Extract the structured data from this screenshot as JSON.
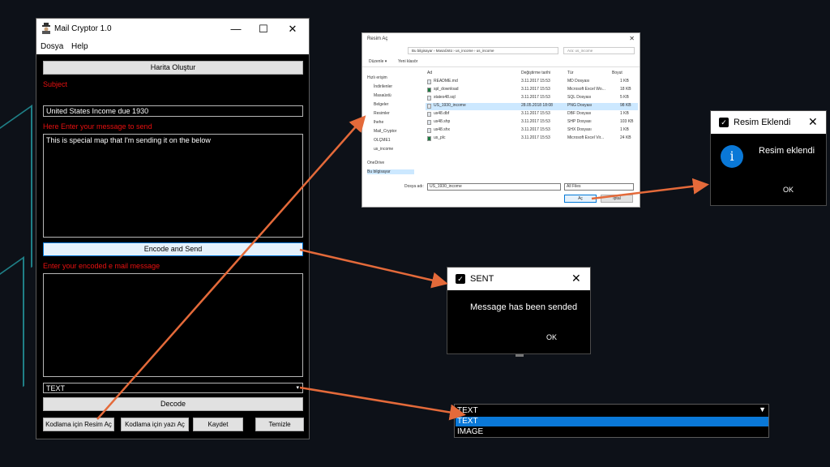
{
  "main_window": {
    "title": "Mail Cryptor 1.0",
    "menu": [
      "Dosya",
      "Help"
    ],
    "map_button": "Harita Oluştur",
    "subject_label": "Subject",
    "subject_value": "United States Income due 1930",
    "message_label": "Here Enter your message to send",
    "message_value": "This is special map that I'm sending it on  the below",
    "encode_button": "Encode and Send",
    "encoded_label": "Enter your encoded e mail message",
    "encoded_value": "",
    "type_select": "TEXT",
    "decode_button": "Decode",
    "open_image_button": "Kodlama için Resim Aç",
    "open_text_button": "Kodlama için  yazı Aç",
    "save_button": "Kaydet",
    "clear_button": "Temizle"
  },
  "file_dialog": {
    "title": "Resim Aç",
    "breadcrumb": "Bu bilgisayar › MasaÜstü › us_income › us_income",
    "search_placeholder": "Ara: us_income",
    "toolbar": [
      "Düzenle ▾",
      "Yeni klasör"
    ],
    "columns": [
      "Ad",
      "Değiştirme tarihi",
      "Tür",
      "Boyut"
    ],
    "sidebar": [
      "Hızlı erişim",
      "İndirilenler",
      "Masaüstü",
      "Belgeler",
      "Resimler",
      "lhehe",
      "Mail_Cryptor",
      "OLÇME1",
      "us_income",
      "OneDrive",
      "Bu bilgisayar"
    ],
    "files": [
      {
        "name": "README.md",
        "date": "3.11.2017 15:53",
        "type": "MD Dosyası",
        "size": "1 KB"
      },
      {
        "name": "spl_download",
        "date": "3.11.2017 15:53",
        "type": "Microsoft Excel Wo...",
        "size": "18 KB"
      },
      {
        "name": "states48.sql",
        "date": "3.11.2017 15:53",
        "type": "SQL Dosyası",
        "size": "5 KB"
      },
      {
        "name": "US_1930_income",
        "date": "28.05.2018 18:08",
        "type": "PNG Dosyası",
        "size": "98 KB"
      },
      {
        "name": "us48.dbf",
        "date": "3.11.2017 15:53",
        "type": "DBF Dosyası",
        "size": "1 KB"
      },
      {
        "name": "us48.shp",
        "date": "3.11.2017 15:53",
        "type": "SHP Dosyası",
        "size": "103 KB"
      },
      {
        "name": "us48.shx",
        "date": "3.11.2017 15:53",
        "type": "SHX Dosyası",
        "size": "1 KB"
      },
      {
        "name": "us_plc",
        "date": "3.11.2017 15:53",
        "type": "Microsoft Excel Vir...",
        "size": "24 KB"
      }
    ],
    "filename_label": "Dosya adı:",
    "filename_value": "US_1930_income",
    "filter": "All Files",
    "open_button": "Aç",
    "cancel_button": "İptal"
  },
  "resim_dialog": {
    "title": "Resim Eklendi",
    "message": "Resim eklendi",
    "ok": "OK"
  },
  "sent_dialog": {
    "title": "SENT",
    "message": "Message has been sended",
    "ok": "OK"
  },
  "dropdown": {
    "selected": "TEXT",
    "options": [
      "TEXT",
      "IMAGE"
    ]
  },
  "colors": {
    "accent_arrow": "#e46a3a",
    "label_red": "#e81010",
    "select_blue": "#0a78d7"
  }
}
